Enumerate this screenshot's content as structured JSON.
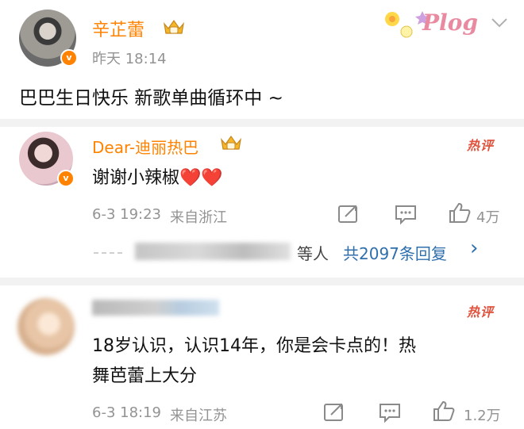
{
  "post": {
    "author": "辛芷蕾",
    "time": "昨天 18:14",
    "text": "巴巴生日快乐 新歌单曲循环中 ~",
    "sticker_text": "Plog",
    "verified_mark": "v"
  },
  "comments": [
    {
      "author": "Dear-迪丽热巴",
      "text": "谢谢小辣椒❤️❤️",
      "date": "6-3 19:23",
      "source": "来自浙江",
      "likes": "4万",
      "hot_label": "热评",
      "verified_mark": "v"
    },
    {
      "author": "",
      "text_line1": "18岁认识，认识14年，你是会卡点的！热",
      "text_line2": "舞芭蕾上大分",
      "date": "6-3 18:19",
      "source": "来自江苏",
      "likes": "1.2万",
      "hot_label": "热评"
    }
  ],
  "reply_summary": {
    "prefix": "等人",
    "count_text": "共2097条回复",
    "chevron": "›"
  },
  "colors": {
    "accent": "#ff8200",
    "hot": "#e0523c",
    "reply_link": "#2f6fad",
    "gray": "#939393"
  },
  "icons": [
    "chevron-down-icon",
    "crown-icon",
    "share-icon",
    "comment-icon",
    "like-icon"
  ]
}
